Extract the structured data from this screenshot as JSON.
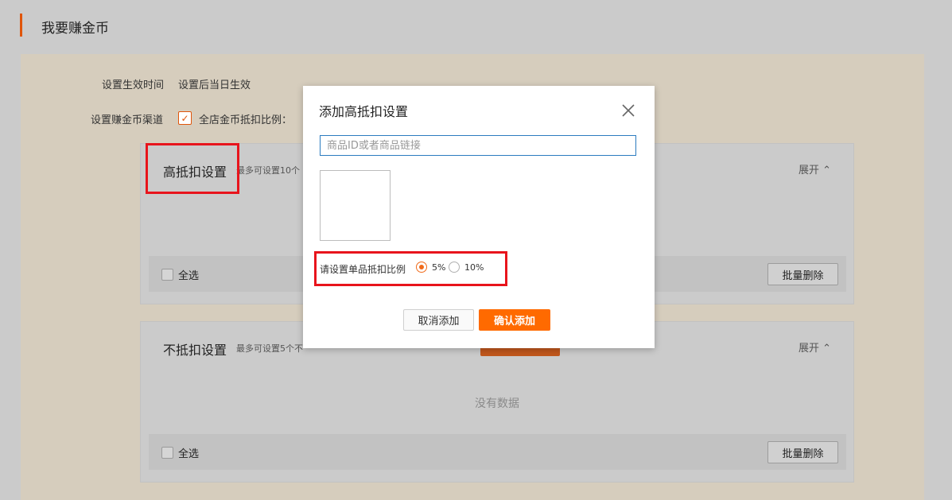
{
  "page": {
    "title": "我要赚金币"
  },
  "settings": {
    "effective_time_label": "设置生效时间",
    "effective_time_value": "设置后当日生效",
    "channel_label": "设置赚金币渠道",
    "channel_checked": true,
    "channel_option": "全店金币抵扣比例："
  },
  "high_section": {
    "title": "高抵扣设置",
    "subtitle": "最多可设置10个",
    "expand": "展开 ⌃",
    "select_all": "全选",
    "batch_delete": "批量删除"
  },
  "no_section": {
    "title": "不抵扣设置",
    "subtitle": "最多可设置5个不",
    "add_button": "",
    "expand": "展开 ⌃",
    "empty_text": "没有数据",
    "select_all": "全选",
    "batch_delete": "批量删除"
  },
  "modal": {
    "title": "添加高抵扣设置",
    "input_placeholder": "商品ID或者商品链接",
    "input_value": "",
    "ratio_label": "请设置单品抵扣比例",
    "ratio_options": [
      {
        "label": "5%",
        "checked": true
      },
      {
        "label": "10%",
        "checked": false
      }
    ],
    "cancel_button": "取消添加",
    "confirm_button": "确认添加"
  },
  "colors": {
    "accent": "#ff6a00",
    "highlight_box": "#e8141c",
    "input_border": "#2b7bbf"
  },
  "icons": {
    "close": "close-icon",
    "check": "checkmark-icon",
    "expand": "chevron-up-icon"
  }
}
